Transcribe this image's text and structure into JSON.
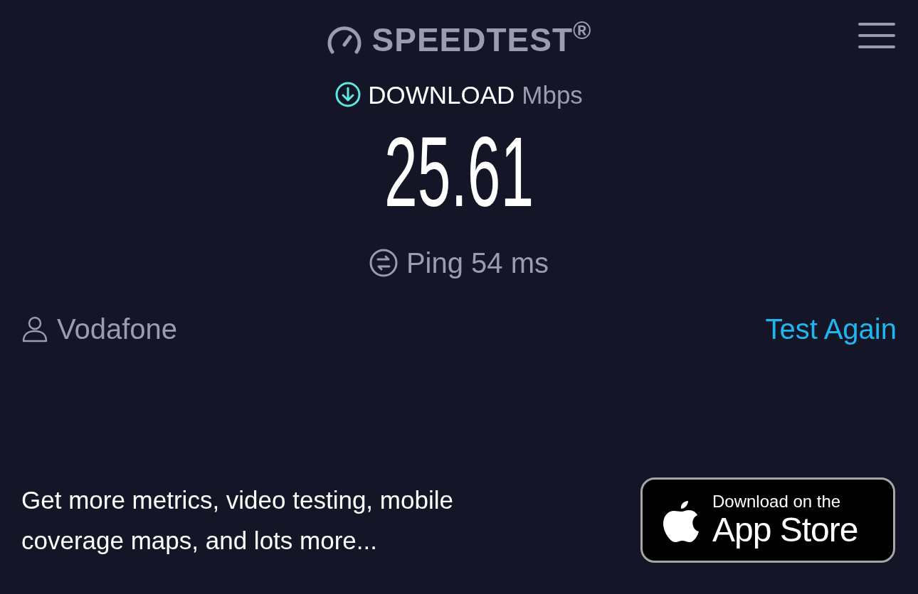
{
  "header": {
    "logo": "SPEEDTEST$^{®}$"
  },
  "result": {
    "direction": "DOWNLOAD",
    "unit": "Mbps",
    "value": "25.61",
    "ping": "Ping 54 ms"
  },
  "provider": "Vodafone",
  "test_again": "Test Again",
  "promo": "Get more metrics, video testing, mobile coverage maps, and lots more...",
  "badge": {
    "line1": "Download on the",
    "line2": "App Store"
  }
}
